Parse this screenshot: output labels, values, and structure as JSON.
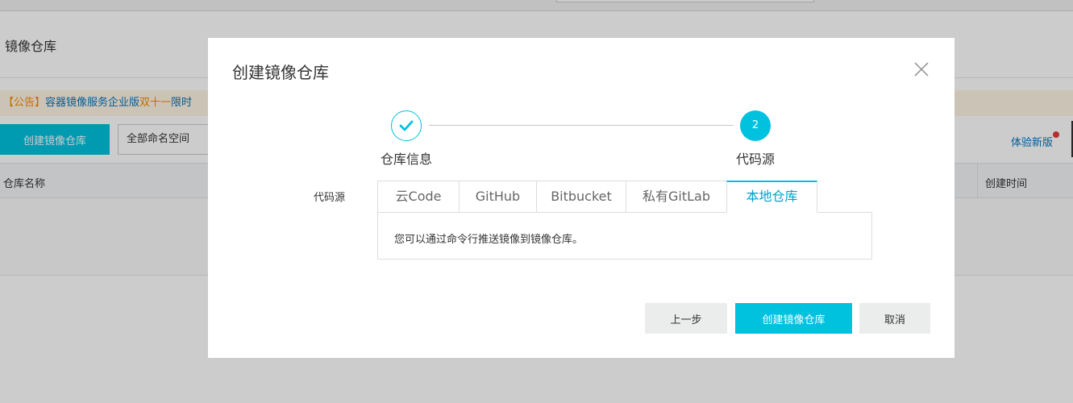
{
  "page": {
    "title": "镜像仓库",
    "notice": {
      "tag": "【公告】",
      "text_blue": "容器镜像服务企业版",
      "text_orange": "双十一",
      "text_blue2": "限时"
    },
    "create_button": "创建镜像仓库",
    "namespace_select": "全部命名空间",
    "try_new_link": "体验新版",
    "table_headers": {
      "name": "仓库名称",
      "created": "创建时间"
    }
  },
  "dialog": {
    "title": "创建镜像仓库",
    "steps": [
      {
        "label": "仓库信息",
        "status": "done"
      },
      {
        "number": "2",
        "label": "代码源",
        "status": "active"
      }
    ],
    "field_label": "代码源",
    "tabs": [
      {
        "label": "云Code",
        "active": false
      },
      {
        "label": "GitHub",
        "active": false
      },
      {
        "label": "Bitbucket",
        "active": false
      },
      {
        "label": "私有GitLab",
        "active": false
      },
      {
        "label": "本地仓库",
        "active": true
      }
    ],
    "panel_text": "您可以通过命令行推送镜像到镜像仓库。",
    "buttons": {
      "prev": "上一步",
      "create": "创建镜像仓库",
      "cancel": "取消"
    }
  },
  "colors": {
    "accent": "#00c1de",
    "link": "#0073bb",
    "notice_orange": "#f08c00",
    "notice_bg": "#fff4e5",
    "badge_red": "#e4393c"
  },
  "icons": {
    "close": "close-icon",
    "step_done": "check-icon"
  }
}
